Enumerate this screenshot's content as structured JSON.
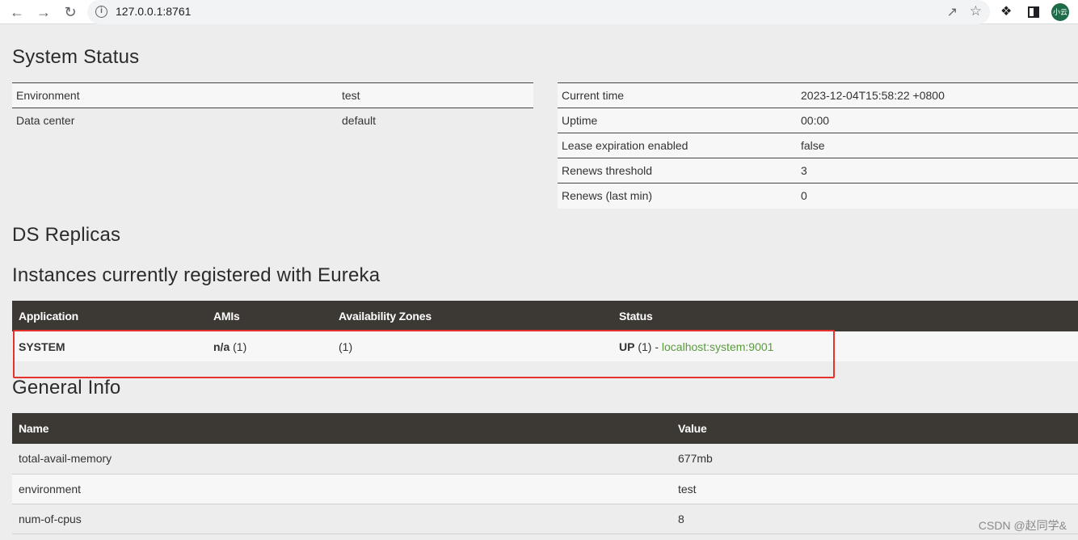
{
  "browser": {
    "url": "127.0.0.1:8761",
    "avatar_text": "小云"
  },
  "system_status": {
    "heading": "System Status",
    "left": [
      {
        "key": "Environment",
        "value": "test"
      },
      {
        "key": "Data center",
        "value": "default"
      }
    ],
    "right": [
      {
        "key": "Current time",
        "value": "2023-12-04T15:58:22 +0800"
      },
      {
        "key": "Uptime",
        "value": "00:00"
      },
      {
        "key": "Lease expiration enabled",
        "value": "false"
      },
      {
        "key": "Renews threshold",
        "value": "3"
      },
      {
        "key": "Renews (last min)",
        "value": "0"
      }
    ]
  },
  "ds_replicas": {
    "heading": "DS Replicas"
  },
  "instances": {
    "heading": "Instances currently registered with Eureka",
    "columns": [
      "Application",
      "AMIs",
      "Availability Zones",
      "Status"
    ],
    "rows": [
      {
        "application": "SYSTEM",
        "ami_label": "n/a",
        "ami_count": "(1)",
        "zones": "(1)",
        "status_label": "UP",
        "status_count": "(1) -",
        "instance_link": "localhost:system:9001"
      }
    ]
  },
  "general_info": {
    "heading": "General Info",
    "columns": [
      "Name",
      "Value"
    ],
    "rows": [
      {
        "name": "total-avail-memory",
        "value": "677mb"
      },
      {
        "name": "environment",
        "value": "test"
      },
      {
        "name": "num-of-cpus",
        "value": "8"
      }
    ]
  },
  "watermark": "CSDN @赵同学&",
  "colors": {
    "header_bg": "#3c3833",
    "link": "#5b9a3f",
    "highlight": "#e5322d"
  }
}
